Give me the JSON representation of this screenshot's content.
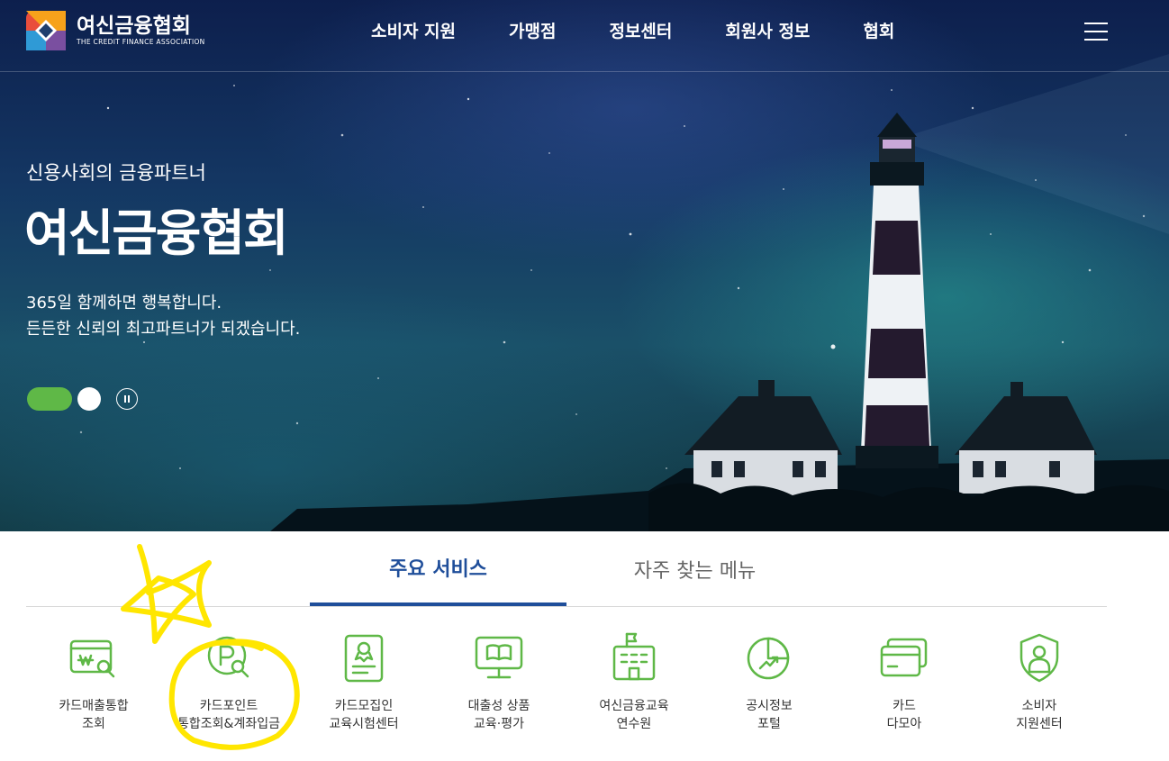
{
  "header": {
    "logo_ko": "여신금융협회",
    "logo_en": "THE CREDIT FINANCE ASSOCIATION",
    "nav": [
      "소비자 지원",
      "가맹점",
      "정보센터",
      "회원사 정보",
      "협회"
    ]
  },
  "hero": {
    "subtitle": "신용사회의 금융파트너",
    "title": "여신금융협회",
    "desc_line1": "365일 함께하면 행복합니다.",
    "desc_line2": "든든한 신뢰의 최고파트너가 되겠습니다."
  },
  "tabs": {
    "main": "주요 서비스",
    "frequent": "자주 찾는 메뉴"
  },
  "services": [
    {
      "icon": "card-sales-search-icon",
      "line1": "카드매출통합",
      "line2": "조회"
    },
    {
      "icon": "card-point-search-icon",
      "line1": "카드포인트",
      "line2": "통합조회&계좌입금"
    },
    {
      "icon": "recruiter-certificate-icon",
      "line1": "카드모집인",
      "line2": "교육시험센터"
    },
    {
      "icon": "education-monitor-icon",
      "line1": "대출성 상품",
      "line2": "교육·평가"
    },
    {
      "icon": "training-building-icon",
      "line1": "여신금융교육",
      "line2": "연수원"
    },
    {
      "icon": "disclosure-chart-icon",
      "line1": "공시정보",
      "line2": "포털"
    },
    {
      "icon": "cards-icon",
      "line1": "카드",
      "line2": "다모아"
    },
    {
      "icon": "consumer-shield-icon",
      "line1": "소비자",
      "line2": "지원센터"
    }
  ],
  "colors": {
    "accent_green": "#5fb847",
    "tab_blue": "#1f4e9a",
    "annotation_yellow": "#ffe600"
  }
}
